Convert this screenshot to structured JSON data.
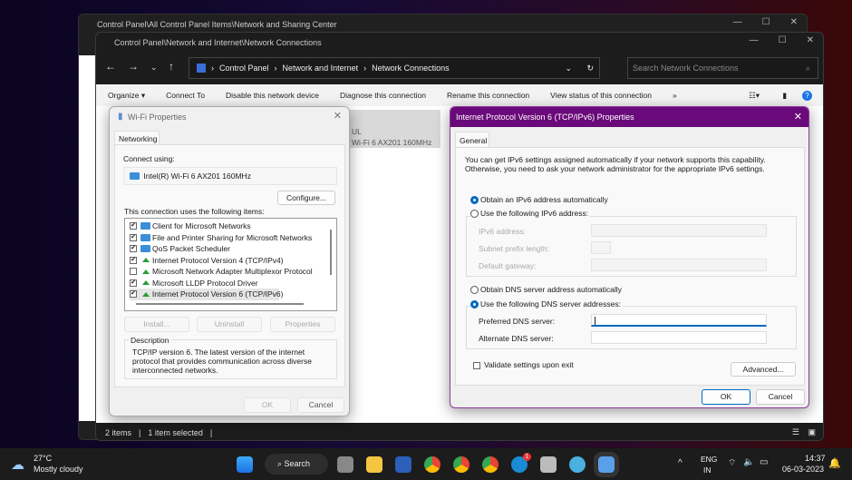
{
  "back_window": {
    "title": "Control Panel\\All Control Panel Items\\Network and Sharing Center"
  },
  "explorer": {
    "title": "Control Panel\\Network and Internet\\Network Connections",
    "breadcrumb": [
      "Control Panel",
      "Network and Internet",
      "Network Connections"
    ],
    "search_placeholder": "Search Network Connections",
    "toolbar": [
      "Organize ▾",
      "Connect To",
      "Disable this network device",
      "Diagnose this connection",
      "Rename this connection",
      "View status of this connection",
      "»"
    ],
    "tile": {
      "line1": "UL",
      "line2": "Wi-Fi 6 AX201 160MHz"
    },
    "status": {
      "items": "2 items",
      "selected": "1 item selected"
    }
  },
  "wifi": {
    "title": "Wi-Fi Properties",
    "tab": "Networking",
    "connect_using": "Connect using:",
    "adapter": "Intel(R) Wi-Fi 6 AX201 160MHz",
    "configure": "Configure...",
    "items_label": "This connection uses the following items:",
    "items": [
      {
        "label": "Client for Microsoft Networks",
        "checked": true,
        "icon": "network"
      },
      {
        "label": "File and Printer Sharing for Microsoft Networks",
        "checked": true,
        "icon": "network"
      },
      {
        "label": "QoS Packet Scheduler",
        "checked": true,
        "icon": "network"
      },
      {
        "label": "Internet Protocol Version 4 (TCP/IPv4)",
        "checked": true,
        "icon": "protocol"
      },
      {
        "label": "Microsoft Network Adapter Multiplexor Protocol",
        "checked": false,
        "icon": "protocol"
      },
      {
        "label": "Microsoft LLDP Protocol Driver",
        "checked": true,
        "icon": "protocol"
      },
      {
        "label": "Internet Protocol Version 6 (TCP/IPv6)",
        "checked": true,
        "icon": "protocol"
      }
    ],
    "install": "Install...",
    "uninstall": "Uninstall",
    "properties": "Properties",
    "description_label": "Description",
    "description": "TCP/IP version 6. The latest version of the internet protocol that provides communication across diverse interconnected networks.",
    "ok": "OK",
    "cancel": "Cancel"
  },
  "ipv6": {
    "title": "Internet Protocol Version 6 (TCP/IPv6) Properties",
    "tab": "General",
    "intro": "You can get IPv6 settings assigned automatically if your network supports this capability. Otherwise, you need to ask your network administrator for the appropriate IPv6 settings.",
    "auto_addr": "Obtain an IPv6 address automatically",
    "manual_addr": "Use the following IPv6 address:",
    "ipv6_address": "IPv6 address:",
    "subnet": "Subnet prefix length:",
    "gateway": "Default gateway:",
    "auto_dns": "Obtain DNS server address automatically",
    "manual_dns": "Use the following DNS server addresses:",
    "preferred": "Preferred DNS server:",
    "alternate": "Alternate DNS server:",
    "preferred_value": "",
    "alternate_value": "",
    "validate": "Validate settings upon exit",
    "advanced": "Advanced...",
    "ok": "OK",
    "cancel": "Cancel",
    "accent": "#6a0a7a"
  },
  "taskbar": {
    "temp": "27°C",
    "weather": "Mostly cloudy",
    "search": "Search",
    "lang1": "ENG",
    "lang2": "IN",
    "time": "14:37",
    "date": "06-03-2023",
    "badge_skype": "1"
  }
}
